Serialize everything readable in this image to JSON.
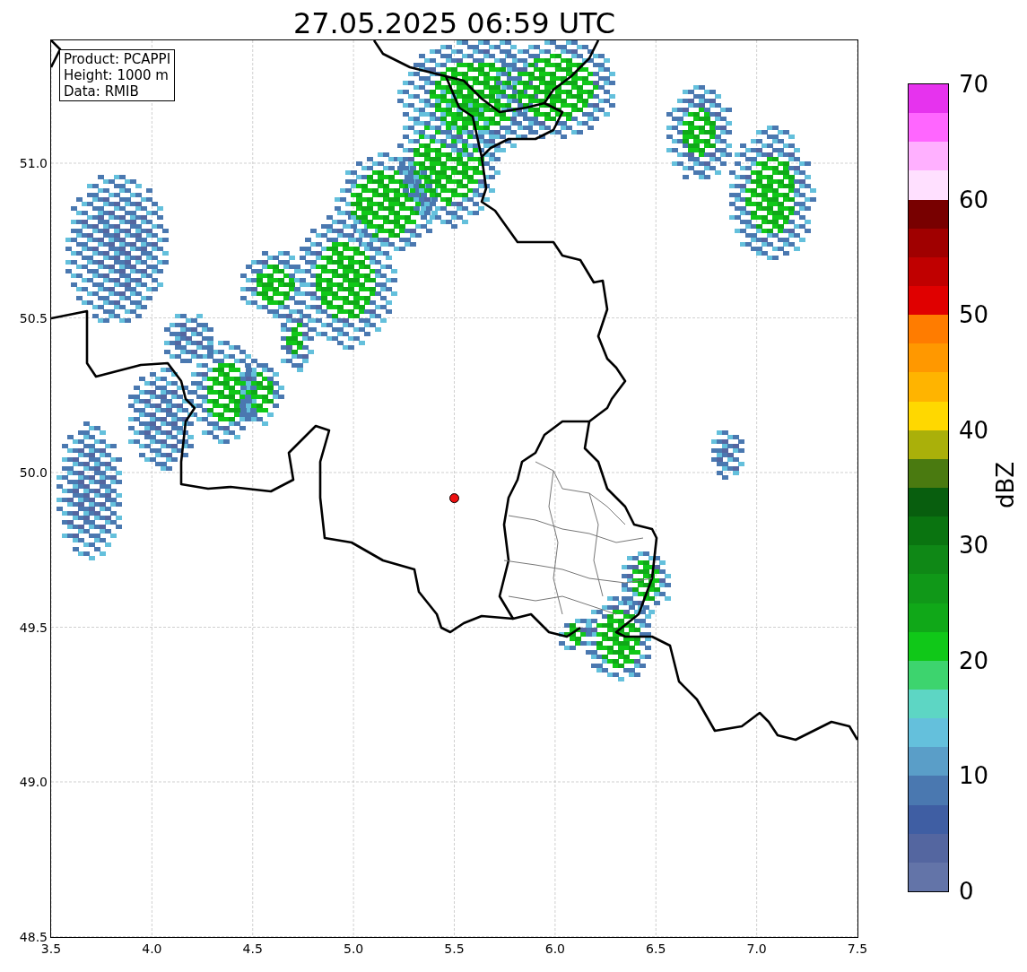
{
  "title": "27.05.2025 06:59 UTC",
  "info_box": [
    "Product: PCAPPI",
    "Height: 1000 m",
    "Data: RMIB"
  ],
  "x_ticks": [
    "3.5",
    "4.0",
    "4.5",
    "5.0",
    "5.5",
    "6.0",
    "6.5",
    "7.0",
    "7.5"
  ],
  "y_ticks": [
    "51.0",
    "50.5",
    "50.0",
    "49.5",
    "49.0",
    "48.5"
  ],
  "colorbar": {
    "label": "dBZ",
    "ticks": [
      "70",
      "60",
      "50",
      "40",
      "30",
      "20",
      "10",
      "0"
    ],
    "bins": [
      {
        "color": "#6374a8"
      },
      {
        "color": "#5466a0"
      },
      {
        "color": "#3f5ea3"
      },
      {
        "color": "#4a78b0"
      },
      {
        "color": "#5a9ec8"
      },
      {
        "color": "#64c0dc"
      },
      {
        "color": "#5dd6c4"
      },
      {
        "color": "#3dd46e"
      },
      {
        "color": "#10c818"
      },
      {
        "color": "#10a818"
      },
      {
        "color": "#109818"
      },
      {
        "color": "#0f8816"
      },
      {
        "color": "#0a7410"
      },
      {
        "color": "#085e0e"
      },
      {
        "color": "#4a7a10"
      },
      {
        "color": "#aab00a"
      },
      {
        "color": "#ffd800"
      },
      {
        "color": "#ffb400"
      },
      {
        "color": "#ff9800"
      },
      {
        "color": "#ff7c00"
      },
      {
        "color": "#e00000"
      },
      {
        "color": "#c00000"
      },
      {
        "color": "#a00000"
      },
      {
        "color": "#780000"
      },
      {
        "color": "#ffe0ff"
      },
      {
        "color": "#ffb0ff"
      },
      {
        "color": "#ff66ff"
      },
      {
        "color": "#e633ee"
      }
    ]
  }
}
